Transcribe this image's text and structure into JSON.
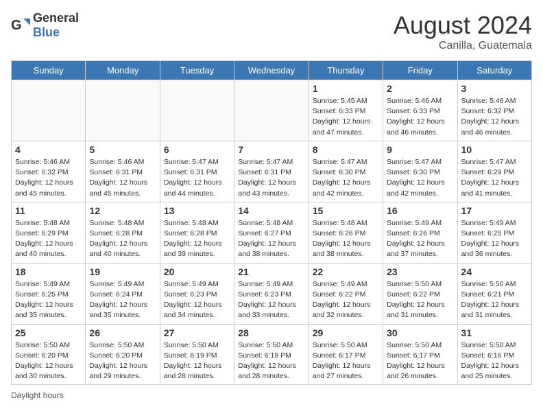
{
  "header": {
    "logo_general": "General",
    "logo_blue": "Blue",
    "main_title": "August 2024",
    "subtitle": "Canilla, Guatemala"
  },
  "days_of_week": [
    "Sunday",
    "Monday",
    "Tuesday",
    "Wednesday",
    "Thursday",
    "Friday",
    "Saturday"
  ],
  "weeks": [
    [
      {
        "day": "",
        "info": ""
      },
      {
        "day": "",
        "info": ""
      },
      {
        "day": "",
        "info": ""
      },
      {
        "day": "",
        "info": ""
      },
      {
        "day": "1",
        "info": "Sunrise: 5:45 AM\nSunset: 6:33 PM\nDaylight: 12 hours\nand 47 minutes."
      },
      {
        "day": "2",
        "info": "Sunrise: 5:46 AM\nSunset: 6:33 PM\nDaylight: 12 hours\nand 46 minutes."
      },
      {
        "day": "3",
        "info": "Sunrise: 5:46 AM\nSunset: 6:32 PM\nDaylight: 12 hours\nand 46 minutes."
      }
    ],
    [
      {
        "day": "4",
        "info": "Sunrise: 5:46 AM\nSunset: 6:32 PM\nDaylight: 12 hours\nand 45 minutes."
      },
      {
        "day": "5",
        "info": "Sunrise: 5:46 AM\nSunset: 6:31 PM\nDaylight: 12 hours\nand 45 minutes."
      },
      {
        "day": "6",
        "info": "Sunrise: 5:47 AM\nSunset: 6:31 PM\nDaylight: 12 hours\nand 44 minutes."
      },
      {
        "day": "7",
        "info": "Sunrise: 5:47 AM\nSunset: 6:31 PM\nDaylight: 12 hours\nand 43 minutes."
      },
      {
        "day": "8",
        "info": "Sunrise: 5:47 AM\nSunset: 6:30 PM\nDaylight: 12 hours\nand 42 minutes."
      },
      {
        "day": "9",
        "info": "Sunrise: 5:47 AM\nSunset: 6:30 PM\nDaylight: 12 hours\nand 42 minutes."
      },
      {
        "day": "10",
        "info": "Sunrise: 5:47 AM\nSunset: 6:29 PM\nDaylight: 12 hours\nand 41 minutes."
      }
    ],
    [
      {
        "day": "11",
        "info": "Sunrise: 5:48 AM\nSunset: 6:29 PM\nDaylight: 12 hours\nand 40 minutes."
      },
      {
        "day": "12",
        "info": "Sunrise: 5:48 AM\nSunset: 6:28 PM\nDaylight: 12 hours\nand 40 minutes."
      },
      {
        "day": "13",
        "info": "Sunrise: 5:48 AM\nSunset: 6:28 PM\nDaylight: 12 hours\nand 39 minutes."
      },
      {
        "day": "14",
        "info": "Sunrise: 5:48 AM\nSunset: 6:27 PM\nDaylight: 12 hours\nand 38 minutes."
      },
      {
        "day": "15",
        "info": "Sunrise: 5:48 AM\nSunset: 6:26 PM\nDaylight: 12 hours\nand 38 minutes."
      },
      {
        "day": "16",
        "info": "Sunrise: 5:49 AM\nSunset: 6:26 PM\nDaylight: 12 hours\nand 37 minutes."
      },
      {
        "day": "17",
        "info": "Sunrise: 5:49 AM\nSunset: 6:25 PM\nDaylight: 12 hours\nand 36 minutes."
      }
    ],
    [
      {
        "day": "18",
        "info": "Sunrise: 5:49 AM\nSunset: 6:25 PM\nDaylight: 12 hours\nand 35 minutes."
      },
      {
        "day": "19",
        "info": "Sunrise: 5:49 AM\nSunset: 6:24 PM\nDaylight: 12 hours\nand 35 minutes."
      },
      {
        "day": "20",
        "info": "Sunrise: 5:49 AM\nSunset: 6:23 PM\nDaylight: 12 hours\nand 34 minutes."
      },
      {
        "day": "21",
        "info": "Sunrise: 5:49 AM\nSunset: 6:23 PM\nDaylight: 12 hours\nand 33 minutes."
      },
      {
        "day": "22",
        "info": "Sunrise: 5:49 AM\nSunset: 6:22 PM\nDaylight: 12 hours\nand 32 minutes."
      },
      {
        "day": "23",
        "info": "Sunrise: 5:50 AM\nSunset: 6:22 PM\nDaylight: 12 hours\nand 31 minutes."
      },
      {
        "day": "24",
        "info": "Sunrise: 5:50 AM\nSunset: 6:21 PM\nDaylight: 12 hours\nand 31 minutes."
      }
    ],
    [
      {
        "day": "25",
        "info": "Sunrise: 5:50 AM\nSunset: 6:20 PM\nDaylight: 12 hours\nand 30 minutes."
      },
      {
        "day": "26",
        "info": "Sunrise: 5:50 AM\nSunset: 6:20 PM\nDaylight: 12 hours\nand 29 minutes."
      },
      {
        "day": "27",
        "info": "Sunrise: 5:50 AM\nSunset: 6:19 PM\nDaylight: 12 hours\nand 28 minutes."
      },
      {
        "day": "28",
        "info": "Sunrise: 5:50 AM\nSunset: 6:18 PM\nDaylight: 12 hours\nand 28 minutes."
      },
      {
        "day": "29",
        "info": "Sunrise: 5:50 AM\nSunset: 6:17 PM\nDaylight: 12 hours\nand 27 minutes."
      },
      {
        "day": "30",
        "info": "Sunrise: 5:50 AM\nSunset: 6:17 PM\nDaylight: 12 hours\nand 26 minutes."
      },
      {
        "day": "31",
        "info": "Sunrise: 5:50 AM\nSunset: 6:16 PM\nDaylight: 12 hours\nand 25 minutes."
      }
    ]
  ],
  "footer": {
    "daylight_label": "Daylight hours"
  }
}
